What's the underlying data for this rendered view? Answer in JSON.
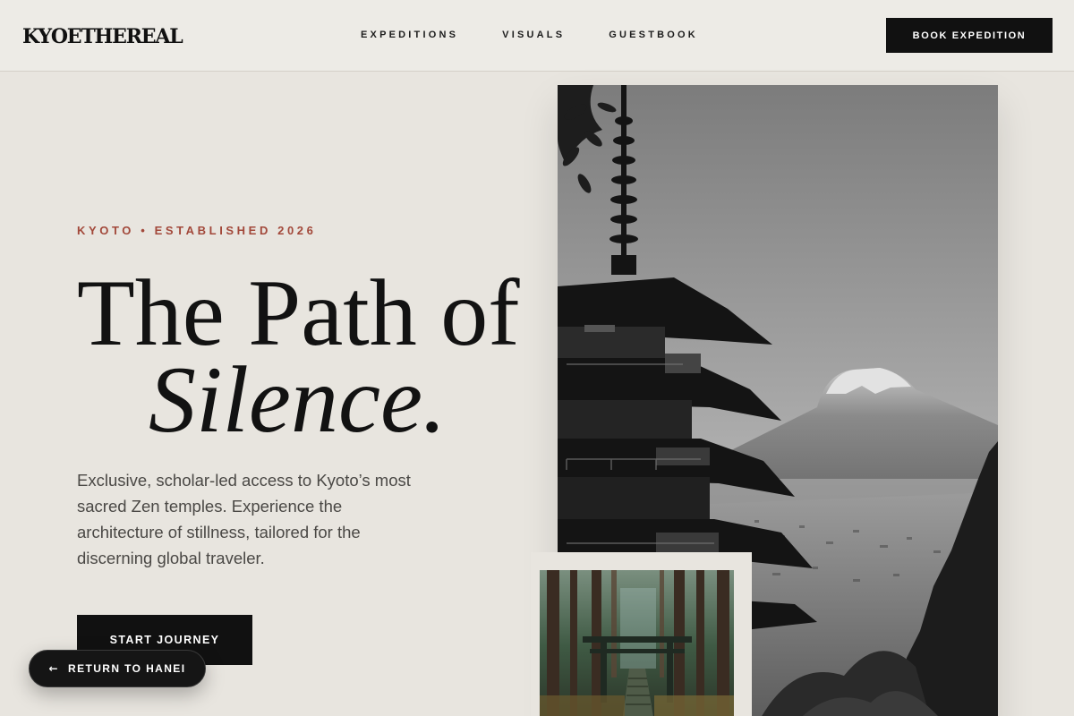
{
  "brand": {
    "logo": "KYOETHEREAL"
  },
  "nav": {
    "items": [
      {
        "label": "EXPEDITIONS"
      },
      {
        "label": "VISUALS"
      },
      {
        "label": "GUESTBOOK"
      }
    ],
    "cta_label": "BOOK EXPEDITION"
  },
  "hero": {
    "eyebrow": "KYOTO • ESTABLISHED 2026",
    "title_line1": "The Path of",
    "title_line2": "Silence.",
    "description": "Exclusive, scholar-led access to Kyoto’s most sacred Zen temples. Experience the architecture of stillness, tailored for the discerning global traveler.",
    "start_label": "START JOURNEY"
  },
  "floating": {
    "return_label": "RETURN TO HANEI",
    "return_icon": "arrow-left-icon"
  },
  "images": {
    "main": "pagoda-mount-fuji-photo",
    "secondary": "forest-torii-gate-photo"
  },
  "colors": {
    "background": "#e8e5df",
    "header": "#edebe6",
    "ink": "#111111",
    "accent": "#a2483a"
  }
}
